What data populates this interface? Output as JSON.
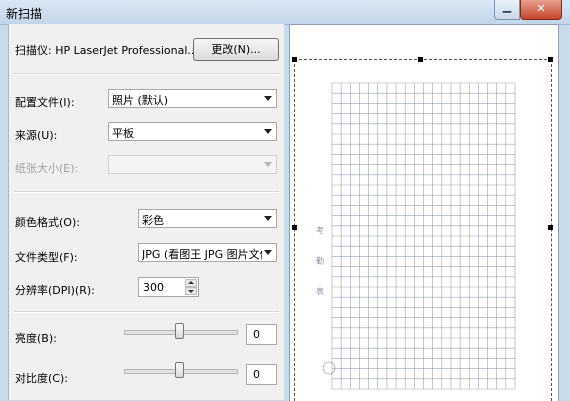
{
  "window": {
    "title": "新扫描",
    "close_glyph": "✕",
    "minimize_glyph": "▁"
  },
  "scanner": {
    "label": "扫描仪: HP LaserJet Professional...",
    "change_button": "更改(N)..."
  },
  "profile": {
    "label": "配置文件(I):",
    "value": "照片 (默认)"
  },
  "source": {
    "label": "来源(U):",
    "value": "平板"
  },
  "paper_size": {
    "label": "纸张大小(E):",
    "value": ""
  },
  "color_format": {
    "label": "颜色格式(O):",
    "value": "彩色"
  },
  "file_type": {
    "label": "文件类型(F):",
    "value": "JPG (看图王 JPG 图片文件"
  },
  "resolution": {
    "label": "分辨率(DPI)(R):",
    "value": "300"
  },
  "brightness": {
    "label": "亮度(B):",
    "value": "0",
    "level": 0
  },
  "contrast": {
    "label": "对比度(C):",
    "value": "0",
    "level": 0
  },
  "preview": {
    "side_title": "考 勤 表",
    "icon": "document-preview"
  }
}
